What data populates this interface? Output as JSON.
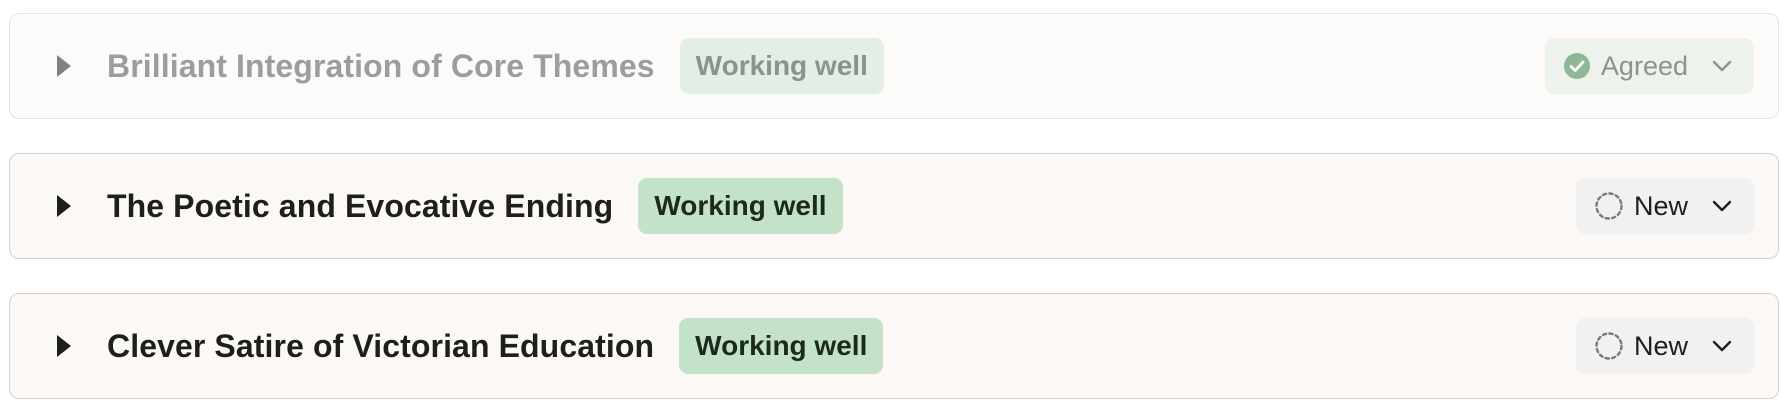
{
  "items": [
    {
      "title": "Brilliant Integration of Core Themes",
      "tag": "Working well",
      "status": "Agreed",
      "status_icon": "check-circle-icon",
      "expander_icon": "caret-right-icon"
    },
    {
      "title": "The Poetic and Evocative Ending",
      "tag": "Working well",
      "status": "New",
      "status_icon": "dashed-circle-icon",
      "expander_icon": "caret-right-icon"
    },
    {
      "title": "Clever Satire of Victorian Education",
      "tag": "Working well",
      "status": "New",
      "status_icon": "dashed-circle-icon",
      "expander_icon": "caret-right-icon"
    }
  ],
  "colors": {
    "tag_background": "#c4e2c7",
    "card_background": "#fcf8f5",
    "agreed_check": "#8fb795",
    "status_background": "#f1f1f1"
  }
}
